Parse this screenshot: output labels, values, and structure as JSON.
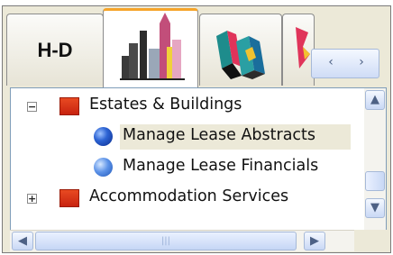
{
  "tabs": [
    {
      "id": "hd",
      "label": "H-D",
      "active": false,
      "icon": "text-label"
    },
    {
      "id": "buildings",
      "label": "",
      "active": true,
      "icon": "city-skyline-icon"
    },
    {
      "id": "boxes",
      "label": "",
      "active": false,
      "icon": "stacked-boxes-icon"
    },
    {
      "id": "partial",
      "label": "",
      "active": false,
      "icon": "partial-tab-icon"
    }
  ],
  "tab_scroller": {
    "left": "‹",
    "right": "›"
  },
  "tree": {
    "items": [
      {
        "label": "Estates & Buildings",
        "expander": "−",
        "icon": "red-folder-icon",
        "level": 0
      },
      {
        "label": "Manage Lease Abstracts",
        "icon": "blue-orb-dark-icon",
        "level": 1,
        "selected": true
      },
      {
        "label": "Manage Lease Financials",
        "icon": "blue-orb-light-icon",
        "level": 1
      },
      {
        "label": "Accommodation Services",
        "expander": "+",
        "icon": "red-folder-icon",
        "level": 0
      }
    ]
  },
  "scrollbars": {
    "up": "▲",
    "down": "▼",
    "left": "◀",
    "right": "▶",
    "grip": "|||"
  },
  "colors": {
    "accent_tab_top": "#f6a42a",
    "folder_red": "#d42e14",
    "selection_bg": "#ece9d8",
    "scroll_blue": "#c9d8f5"
  }
}
